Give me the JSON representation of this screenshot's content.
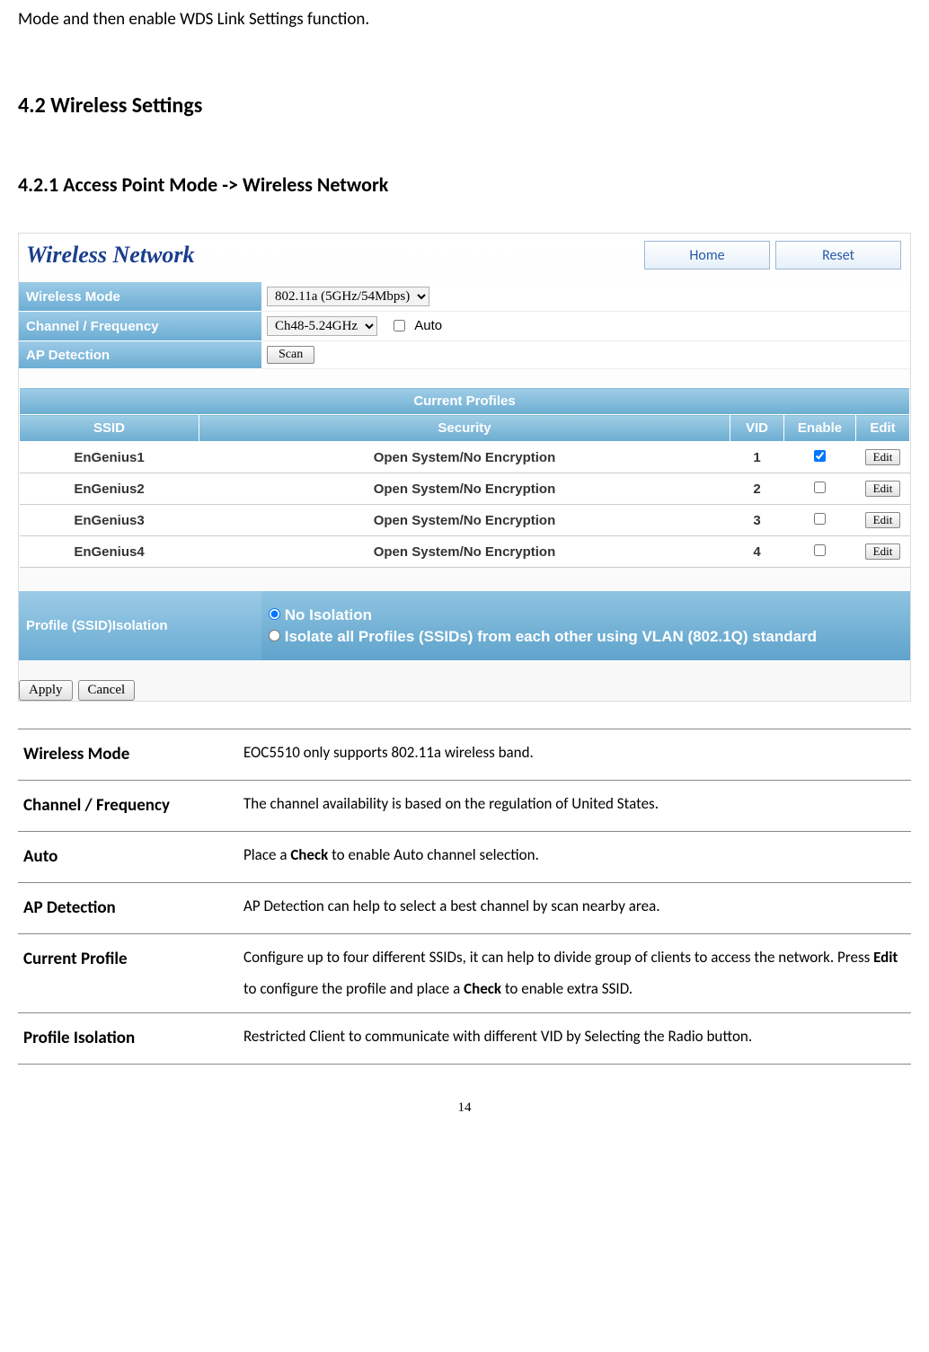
{
  "top_fragment": "Mode and then enable WDS Link Settings function.",
  "sections": {
    "h2": "4.2 Wireless Settings",
    "h3": "4.2.1 Access Point Mode -> Wireless Network"
  },
  "panel": {
    "title": "Wireless Network",
    "home_btn": "Home",
    "reset_btn": "Reset"
  },
  "settings": {
    "wireless_mode_label": "Wireless Mode",
    "wireless_mode_value": "802.11a (5GHz/54Mbps)",
    "channel_label": "Channel / Frequency",
    "channel_value": "Ch48-5.24GHz",
    "auto_label": "Auto",
    "ap_detection_label": "AP Detection",
    "scan_btn": "Scan"
  },
  "profiles": {
    "header": "Current Profiles",
    "cols": {
      "ssid": "SSID",
      "security": "Security",
      "vid": "VID",
      "enable": "Enable",
      "edit": "Edit"
    },
    "rows": [
      {
        "ssid": "EnGenius1",
        "security": "Open System/No Encryption",
        "vid": "1",
        "enabled": true
      },
      {
        "ssid": "EnGenius2",
        "security": "Open System/No Encryption",
        "vid": "2",
        "enabled": false
      },
      {
        "ssid": "EnGenius3",
        "security": "Open System/No Encryption",
        "vid": "3",
        "enabled": false
      },
      {
        "ssid": "EnGenius4",
        "security": "Open System/No Encryption",
        "vid": "4",
        "enabled": false
      }
    ],
    "edit_btn": "Edit"
  },
  "isolation": {
    "label": "Profile (SSID)Isolation",
    "opt1": "No Isolation",
    "opt2": "Isolate all Profiles (SSIDs) from each other using VLAN (802.1Q) standard",
    "selected": "opt1"
  },
  "footer_btns": {
    "apply": "Apply",
    "cancel": "Cancel"
  },
  "definitions": [
    {
      "term": "Wireless Mode",
      "desc": "EOC5510 only supports 802.11a wireless band."
    },
    {
      "term": "Channel / Frequency",
      "desc": "The channel availability is based on the regulation of United States."
    },
    {
      "term": "Auto",
      "desc_pre": "Place a ",
      "desc_bold": "Check",
      "desc_post": " to enable Auto channel selection."
    },
    {
      "term": "AP Detection",
      "desc": "AP Detection can help to select a best channel by scan nearby area."
    },
    {
      "term": "Current Profile",
      "desc_pre": "Configure up to four different SSIDs, it can help to divide group of clients to access the network. Press ",
      "desc_bold": "Edit",
      "desc_mid": " to configure the profile and place a ",
      "desc_bold2": "Check",
      "desc_post": " to enable extra SSID."
    },
    {
      "term": "Profile Isolation",
      "desc": "Restricted Client to communicate with different VID by Selecting the Radio button."
    }
  ],
  "page_number": "14"
}
